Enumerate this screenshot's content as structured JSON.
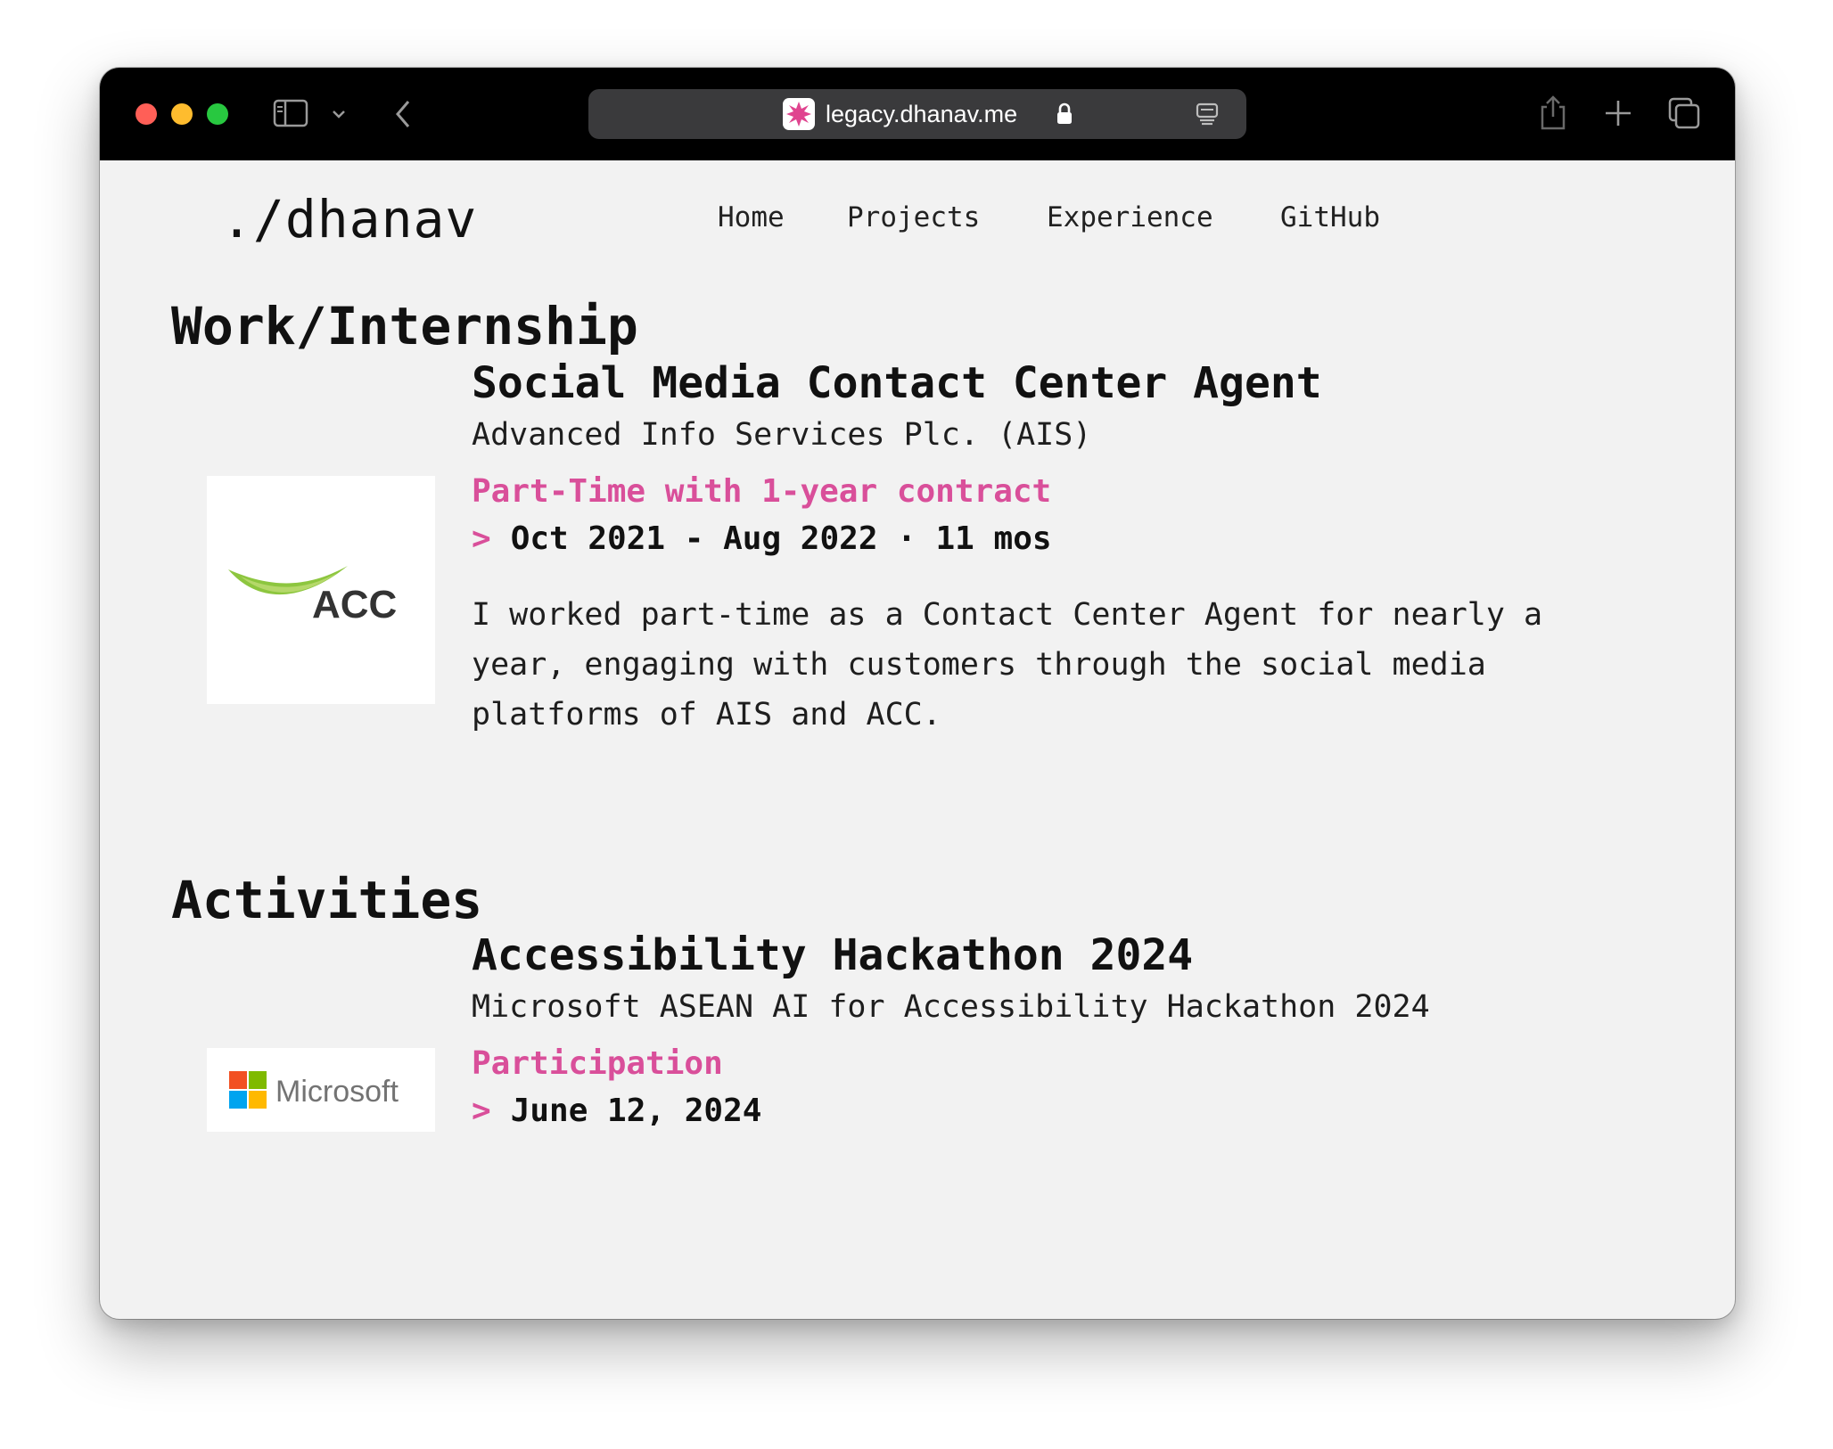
{
  "browser": {
    "url": "legacy.dhanav.me",
    "icons": {
      "sidebar": "sidebar-icon",
      "tab_group_menu": "chevron-down-icon",
      "back": "back-arrow-icon",
      "lock": "lock-icon",
      "reader": "reader-icon",
      "share": "share-icon",
      "new_tab": "plus-icon",
      "tab_overview": "tabs-icon"
    }
  },
  "site": {
    "logo": "./dhanav",
    "nav": [
      "Home",
      "Projects",
      "Experience",
      "GitHub"
    ]
  },
  "work": {
    "heading": "Work/Internship",
    "logo_text": "ACC",
    "title": "Social Media Contact Center Agent",
    "org": "Advanced Info Services Plc. (AIS)",
    "type": "Part-Time with 1-year contract",
    "caret": ">",
    "dates": "Oct 2021 - Aug 2022 · 11 mos",
    "description": "I worked part-time as a Contact Center Agent for nearly a year, engaging with customers through the social media platforms of AIS and ACC."
  },
  "activities": {
    "heading": "Activities",
    "logo_text": "Microsoft",
    "title": "Accessibility Hackathon 2024",
    "org": "Microsoft ASEAN AI for Accessibility Hackathon 2024",
    "type": "Participation",
    "caret": ">",
    "dates": "June 12, 2024"
  },
  "colors": {
    "accent": "#d94f9a",
    "page_bg": "#f2f2f2",
    "titlebar": "#000000",
    "acc_green": "#8dc63f",
    "ms_red": "#f25022",
    "ms_green": "#7fba00",
    "ms_blue": "#00a4ef",
    "ms_yellow": "#ffb900"
  }
}
